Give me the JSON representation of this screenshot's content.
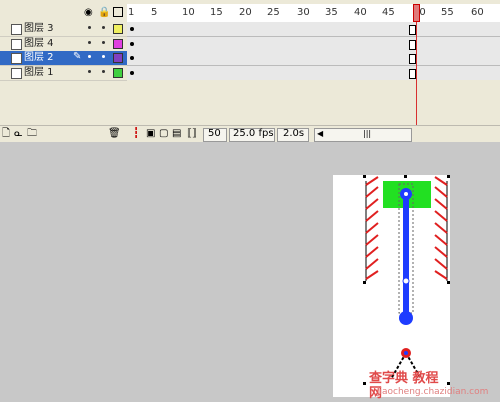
{
  "timeline": {
    "header_icons": [
      "eye-icon",
      "lock-icon",
      "outline-icon"
    ],
    "ruler_labels": [
      "1",
      "5",
      "10",
      "15",
      "20",
      "25",
      "30",
      "35",
      "40",
      "45",
      "50",
      "55",
      "60"
    ],
    "layers": [
      {
        "name": "图层 3",
        "color": "#f0f060",
        "selected": false
      },
      {
        "name": "图层 4",
        "color": "#e040e0",
        "selected": false
      },
      {
        "name": "图层 2",
        "color": "#8040c0",
        "selected": true
      },
      {
        "name": "图层 1",
        "color": "#40d040",
        "selected": false
      }
    ],
    "status": {
      "current_frame": "50",
      "frame_rate": "25.0 fps",
      "elapsed": "2.0s"
    }
  },
  "stage": {
    "watermark_text": "查字典 教程网",
    "watermark_url": "jiaocheng.chazidian.com"
  },
  "colors": {
    "selection": "#316ac5",
    "playhead": "#d83030",
    "arm_blue": "#1e3cff",
    "green_block": "#22e022",
    "hatch_red": "#e02020"
  }
}
